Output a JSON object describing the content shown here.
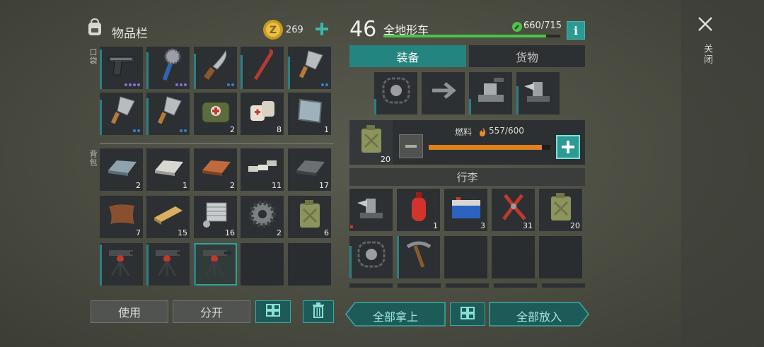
{
  "inventory": {
    "title": "物品栏",
    "coins": "269",
    "section_pocket": "口袋",
    "section_backpack": "背包",
    "pocket": [
      {
        "icon": "pistol-icon",
        "count": "",
        "dots": [
          "#8b6cd6",
          "#8b6cd6",
          "#8b6cd6",
          "#8b6cd6"
        ]
      },
      {
        "icon": "saw-club-icon",
        "count": "",
        "dots": [
          "#8b6cd6",
          "#8b6cd6",
          "#8b6cd6"
        ]
      },
      {
        "icon": "machete-icon",
        "count": "",
        "dots": [
          "#2f84c9",
          "#2f84c9"
        ]
      },
      {
        "icon": "crowbar-icon",
        "count": "",
        "dots": []
      },
      {
        "icon": "cleaver-icon",
        "count": "",
        "dots": [
          "#2f84c9",
          "#2f84c9"
        ]
      },
      {
        "icon": "cleaver-icon",
        "count": "",
        "dots": [
          "#2f84c9",
          "#2f84c9"
        ]
      },
      {
        "icon": "cleaver-icon",
        "count": "",
        "dots": [
          "#2f84c9",
          "#2f84c9"
        ]
      },
      {
        "icon": "medkit-bag-icon",
        "count": "2",
        "dots": []
      },
      {
        "icon": "bandage-icon",
        "count": "8",
        "dots": []
      },
      {
        "icon": "glass-sheet-icon",
        "count": "1",
        "dots": []
      }
    ],
    "backpack": [
      {
        "icon": "iron-ingot-icon",
        "count": "2"
      },
      {
        "icon": "silver-ingot-icon",
        "count": "1"
      },
      {
        "icon": "copper-ingot-icon",
        "count": "2"
      },
      {
        "icon": "aluminum-bars-icon",
        "count": "11"
      },
      {
        "icon": "steel-ingot-icon",
        "count": "17"
      },
      {
        "icon": "leather-icon",
        "count": "7"
      },
      {
        "icon": "planks-icon",
        "count": "15"
      },
      {
        "icon": "engine-parts-icon",
        "count": "16"
      },
      {
        "icon": "gear-icon",
        "count": "2"
      },
      {
        "icon": "jerrycan-icon",
        "count": "6"
      },
      {
        "icon": "turret-icon",
        "count": ""
      },
      {
        "icon": "turret-icon",
        "count": ""
      },
      {
        "icon": "turret-icon",
        "count": ""
      },
      {
        "icon": "",
        "count": ""
      },
      {
        "icon": "",
        "count": ""
      }
    ],
    "buttons": {
      "use": "使用",
      "split": "分开"
    }
  },
  "vehicle": {
    "level": "46",
    "name": "全地形车",
    "durability": "660/715",
    "durability_fraction": 0.92,
    "tabs": [
      "装备",
      "货物"
    ],
    "fuel_label": "燃料",
    "fuel_value": "557/600",
    "fuel_fraction": 0.93,
    "fuel_can_count": "20",
    "luggage_title": "行李",
    "equipment": [
      {
        "icon": "tire-tread-icon"
      },
      {
        "icon": "arrow-right-icon"
      },
      {
        "icon": "vise-icon"
      },
      {
        "icon": "drill-icon"
      }
    ],
    "luggage": [
      {
        "icon": "drill-icon",
        "count": "",
        "red": true
      },
      {
        "icon": "gas-cylinder-icon",
        "count": "1"
      },
      {
        "icon": "battery-icon",
        "count": "3"
      },
      {
        "icon": "pliers-icon",
        "count": "31"
      },
      {
        "icon": "jerrycan-icon",
        "count": "20"
      },
      {
        "icon": "tire-tread-icon",
        "count": ""
      },
      {
        "icon": "pickaxe-icon",
        "count": ""
      },
      {
        "icon": "",
        "count": ""
      },
      {
        "icon": "",
        "count": ""
      },
      {
        "icon": "",
        "count": ""
      }
    ],
    "buttons": {
      "take_all": "全部拿上",
      "put_all": "全部放入"
    }
  },
  "close_label": "关闭"
}
